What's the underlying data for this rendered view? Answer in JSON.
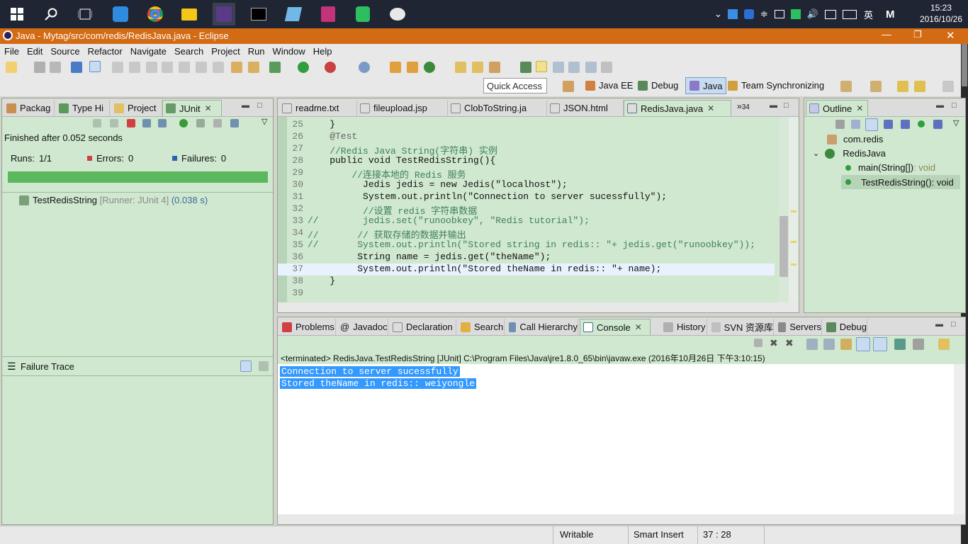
{
  "taskbar": {
    "clock_time": "15:23",
    "clock_date": "2016/10/26",
    "ime": "英",
    "ime2": "M"
  },
  "window": {
    "title": "Java - Mytag/src/com/redis/RedisJava.java - Eclipse"
  },
  "menu": [
    "File",
    "Edit",
    "Source",
    "Refactor",
    "Navigate",
    "Search",
    "Project",
    "Run",
    "Window",
    "Help"
  ],
  "toolbar": {
    "quick_access_placeholder": "Quick Access",
    "perspectives": [
      "Java EE",
      "Debug",
      "Java",
      "Team Synchronizing"
    ]
  },
  "left_view": {
    "tabs": [
      "Packag",
      "Type Hi",
      "Project",
      "JUnit"
    ],
    "finished": "Finished after 0.052 seconds",
    "runs_label": "Runs:",
    "runs": "1/1",
    "errors_label": "Errors:",
    "errors": "0",
    "failures_label": "Failures:",
    "failures": "0",
    "test_name": "TestRedisString",
    "test_detail": "[Runner: JUnit 4]",
    "test_time": "(0.038 s)",
    "failure_trace": "Failure Trace"
  },
  "editor": {
    "tabs": [
      "readme.txt",
      "fileupload.jsp",
      "ClobToString.ja",
      "JSON.html",
      "RedisJava.java"
    ],
    "overflow": "34",
    "lines": [
      {
        "n": "25",
        "t": "    }"
      },
      {
        "n": "26",
        "t": "    @Test"
      },
      {
        "n": "27",
        "t": "    //Redis Java String(字符串) 实例"
      },
      {
        "n": "28",
        "t": "    public void TestRedisString(){"
      },
      {
        "n": "29",
        "t": "        //连接本地的 Redis 服务"
      },
      {
        "n": "30",
        "t": "          Jedis jedis = new Jedis(\"localhost\");"
      },
      {
        "n": "31",
        "t": "          System.out.println(\"Connection to server sucessfully\");"
      },
      {
        "n": "32",
        "t": "          //设置 redis 字符串数据"
      },
      {
        "n": "33",
        "t": "//        jedis.set(\"runoobkey\", \"Redis tutorial\");"
      },
      {
        "n": "34",
        "t": "//       // 获取存储的数据并输出"
      },
      {
        "n": "35",
        "t": "//       System.out.println(\"Stored string in redis:: \"+ jedis.get(\"runoobkey\"));"
      },
      {
        "n": "36",
        "t": "         String name = jedis.get(\"theName\");"
      },
      {
        "n": "37",
        "t": "         System.out.println(\"Stored theName in redis:: \"+ name);"
      },
      {
        "n": "38",
        "t": "    }"
      },
      {
        "n": "39",
        "t": ""
      }
    ]
  },
  "outline": {
    "tab": "Outline",
    "package": "com.redis",
    "class": "RedisJava",
    "methods": [
      {
        "name": "main(String[])",
        "type": " : void"
      },
      {
        "name": "TestRedisString()",
        "type": " : void"
      }
    ]
  },
  "bottom": {
    "tabs": [
      "Problems",
      "Javadoc",
      "Declaration",
      "Search",
      "Call Hierarchy",
      "Console",
      "History",
      "SVN 资源库",
      "Servers",
      "Debug"
    ],
    "terminated": "<terminated> RedisJava.TestRedisString [JUnit] C:\\Program Files\\Java\\jre1.8.0_65\\bin\\javaw.exe (2016年10月26日 下午3:10:15)",
    "output": [
      "Connection to server sucessfully",
      "Stored theName in redis:: weiyongle"
    ]
  },
  "status": {
    "writable": "Writable",
    "insert": "Smart Insert",
    "pos": "37 : 28"
  },
  "colors": {
    "accent": "#d36b14",
    "view_bg": "#cfe8cf",
    "progress": "#5cb85c"
  }
}
